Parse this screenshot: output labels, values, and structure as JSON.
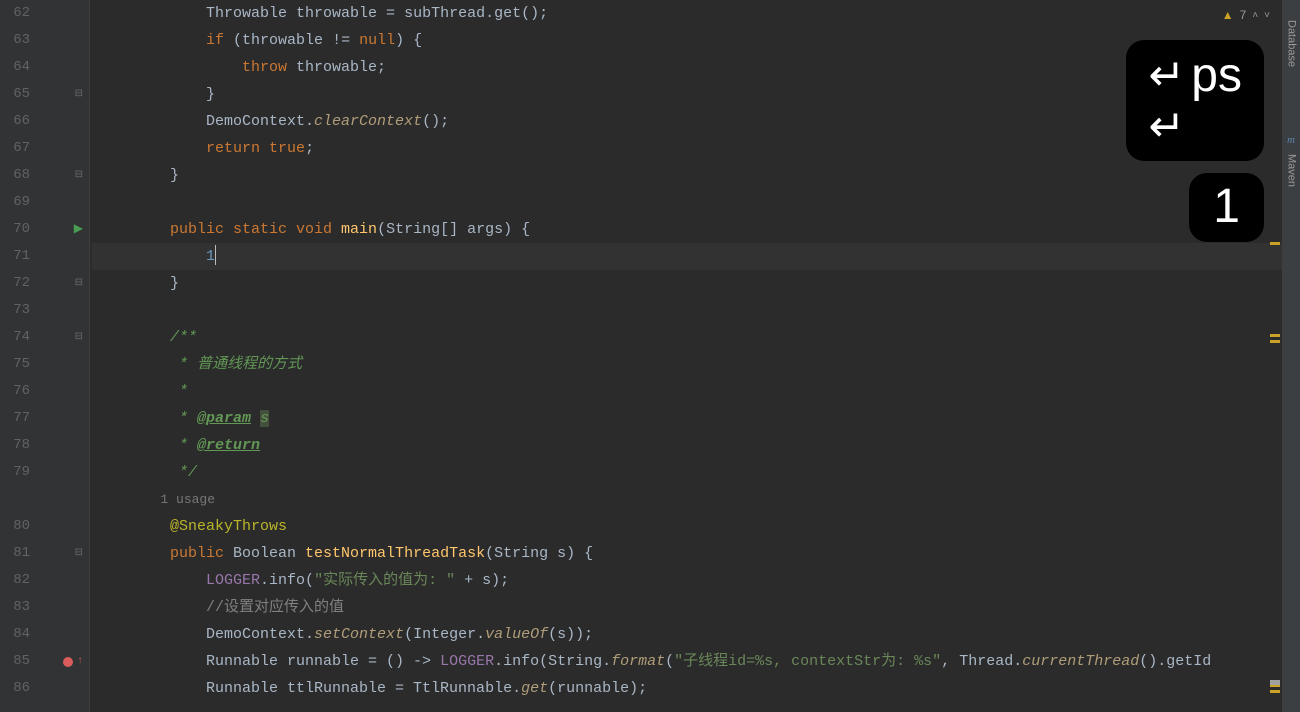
{
  "warning": {
    "count": "7"
  },
  "rightTools": {
    "database": "Database",
    "maven": "Maven"
  },
  "keyOverlay": {
    "typed": "ps",
    "count": "1"
  },
  "usage_label": "1 usage",
  "lines": [
    {
      "n": "62",
      "icon": "",
      "tokens": [
        [
          "",
          "            "
        ],
        [
          "",
          "Throwable throwable = subThread.get();"
        ]
      ]
    },
    {
      "n": "63",
      "icon": "",
      "tokens": [
        [
          "",
          "            "
        ],
        [
          "k",
          "if"
        ],
        [
          "",
          " (throwable != "
        ],
        [
          "k",
          "null"
        ],
        [
          "",
          ") {"
        ]
      ]
    },
    {
      "n": "64",
      "icon": "",
      "tokens": [
        [
          "",
          "                "
        ],
        [
          "k",
          "throw"
        ],
        [
          "",
          " throwable;"
        ]
      ]
    },
    {
      "n": "65",
      "icon": "fold",
      "tokens": [
        [
          "",
          "            }"
        ]
      ]
    },
    {
      "n": "66",
      "icon": "",
      "tokens": [
        [
          "",
          "            DemoContext."
        ],
        [
          "mi",
          "clearContext"
        ],
        [
          "",
          "();"
        ]
      ]
    },
    {
      "n": "67",
      "icon": "",
      "tokens": [
        [
          "",
          "            "
        ],
        [
          "k",
          "return "
        ],
        [
          "k",
          "true"
        ],
        [
          "",
          ";"
        ]
      ]
    },
    {
      "n": "68",
      "icon": "fold",
      "tokens": [
        [
          "",
          "        }"
        ]
      ]
    },
    {
      "n": "69",
      "icon": "",
      "tokens": [
        [
          "",
          ""
        ]
      ]
    },
    {
      "n": "70",
      "icon": "run",
      "tokens": [
        [
          "",
          "        "
        ],
        [
          "k",
          "public static void "
        ],
        [
          "m",
          "main"
        ],
        [
          "",
          "(String[] args) {"
        ]
      ]
    },
    {
      "n": "71",
      "icon": "",
      "current": true,
      "tokens": [
        [
          "",
          "            "
        ],
        [
          "n",
          "1"
        ],
        [
          "caret",
          ""
        ]
      ]
    },
    {
      "n": "72",
      "icon": "fold",
      "tokens": [
        [
          "",
          "        }"
        ]
      ]
    },
    {
      "n": "73",
      "icon": "",
      "tokens": [
        [
          "",
          ""
        ]
      ]
    },
    {
      "n": "74",
      "icon": "fold",
      "tokens": [
        [
          "",
          "        "
        ],
        [
          "jdoc",
          "/**"
        ]
      ]
    },
    {
      "n": "75",
      "icon": "",
      "tokens": [
        [
          "",
          "         "
        ],
        [
          "jdoc",
          "* 普通线程的方式"
        ]
      ]
    },
    {
      "n": "76",
      "icon": "",
      "tokens": [
        [
          "",
          "         "
        ],
        [
          "jdoc",
          "*"
        ]
      ]
    },
    {
      "n": "77",
      "icon": "",
      "tokens": [
        [
          "",
          "         "
        ],
        [
          "jdoc",
          "* "
        ],
        [
          "jdoc-tag",
          "@param"
        ],
        [
          "jdoc",
          " "
        ],
        [
          "jdoc-param",
          "s"
        ]
      ]
    },
    {
      "n": "78",
      "icon": "",
      "tokens": [
        [
          "",
          "         "
        ],
        [
          "jdoc",
          "* "
        ],
        [
          "jdoc-tag",
          "@return"
        ]
      ]
    },
    {
      "n": "79",
      "icon": "",
      "tokens": [
        [
          "",
          "         "
        ],
        [
          "jdoc",
          "*/"
        ]
      ]
    },
    {
      "n": "",
      "icon": "",
      "usage": true,
      "tokens": [
        [
          "usage",
          "        1 usage"
        ]
      ]
    },
    {
      "n": "80",
      "icon": "",
      "tokens": [
        [
          "",
          "        "
        ],
        [
          "anno",
          "@SneakyThrows"
        ]
      ]
    },
    {
      "n": "81",
      "icon": "fold",
      "tokens": [
        [
          "",
          "        "
        ],
        [
          "k",
          "public"
        ],
        [
          "",
          " Boolean "
        ],
        [
          "m",
          "testNormalThreadTask"
        ],
        [
          "",
          "(String s) {"
        ]
      ]
    },
    {
      "n": "82",
      "icon": "",
      "tokens": [
        [
          "",
          "            "
        ],
        [
          "fld",
          "LOGGER"
        ],
        [
          "",
          ".info("
        ],
        [
          "s",
          "\"实际传入的值为: \""
        ],
        [
          "",
          " + s);"
        ]
      ]
    },
    {
      "n": "83",
      "icon": "",
      "tokens": [
        [
          "",
          "            "
        ],
        [
          "c",
          "//设置对应传入的值"
        ]
      ]
    },
    {
      "n": "84",
      "icon": "",
      "tokens": [
        [
          "",
          "            DemoContext."
        ],
        [
          "mi",
          "setContext"
        ],
        [
          "",
          "(Integer."
        ],
        [
          "mi",
          "valueOf"
        ],
        [
          "",
          "(s));"
        ]
      ]
    },
    {
      "n": "85",
      "icon": "bp",
      "tokens": [
        [
          "",
          "            Runnable runnable = () -> "
        ],
        [
          "fld",
          "LOGGER"
        ],
        [
          "",
          ".info(String."
        ],
        [
          "mi",
          "format"
        ],
        [
          "",
          "("
        ],
        [
          "s",
          "\"子线程id=%s, contextStr为: %s\""
        ],
        [
          "",
          ", Thread."
        ],
        [
          "mi",
          "currentThread"
        ],
        [
          "",
          "().getId"
        ]
      ]
    },
    {
      "n": "86",
      "icon": "",
      "tokens": [
        [
          "",
          "            Runnable ttlRunnable = TtlRunnable."
        ],
        [
          "mi",
          "get"
        ],
        [
          "",
          "(runnable);"
        ]
      ]
    }
  ]
}
